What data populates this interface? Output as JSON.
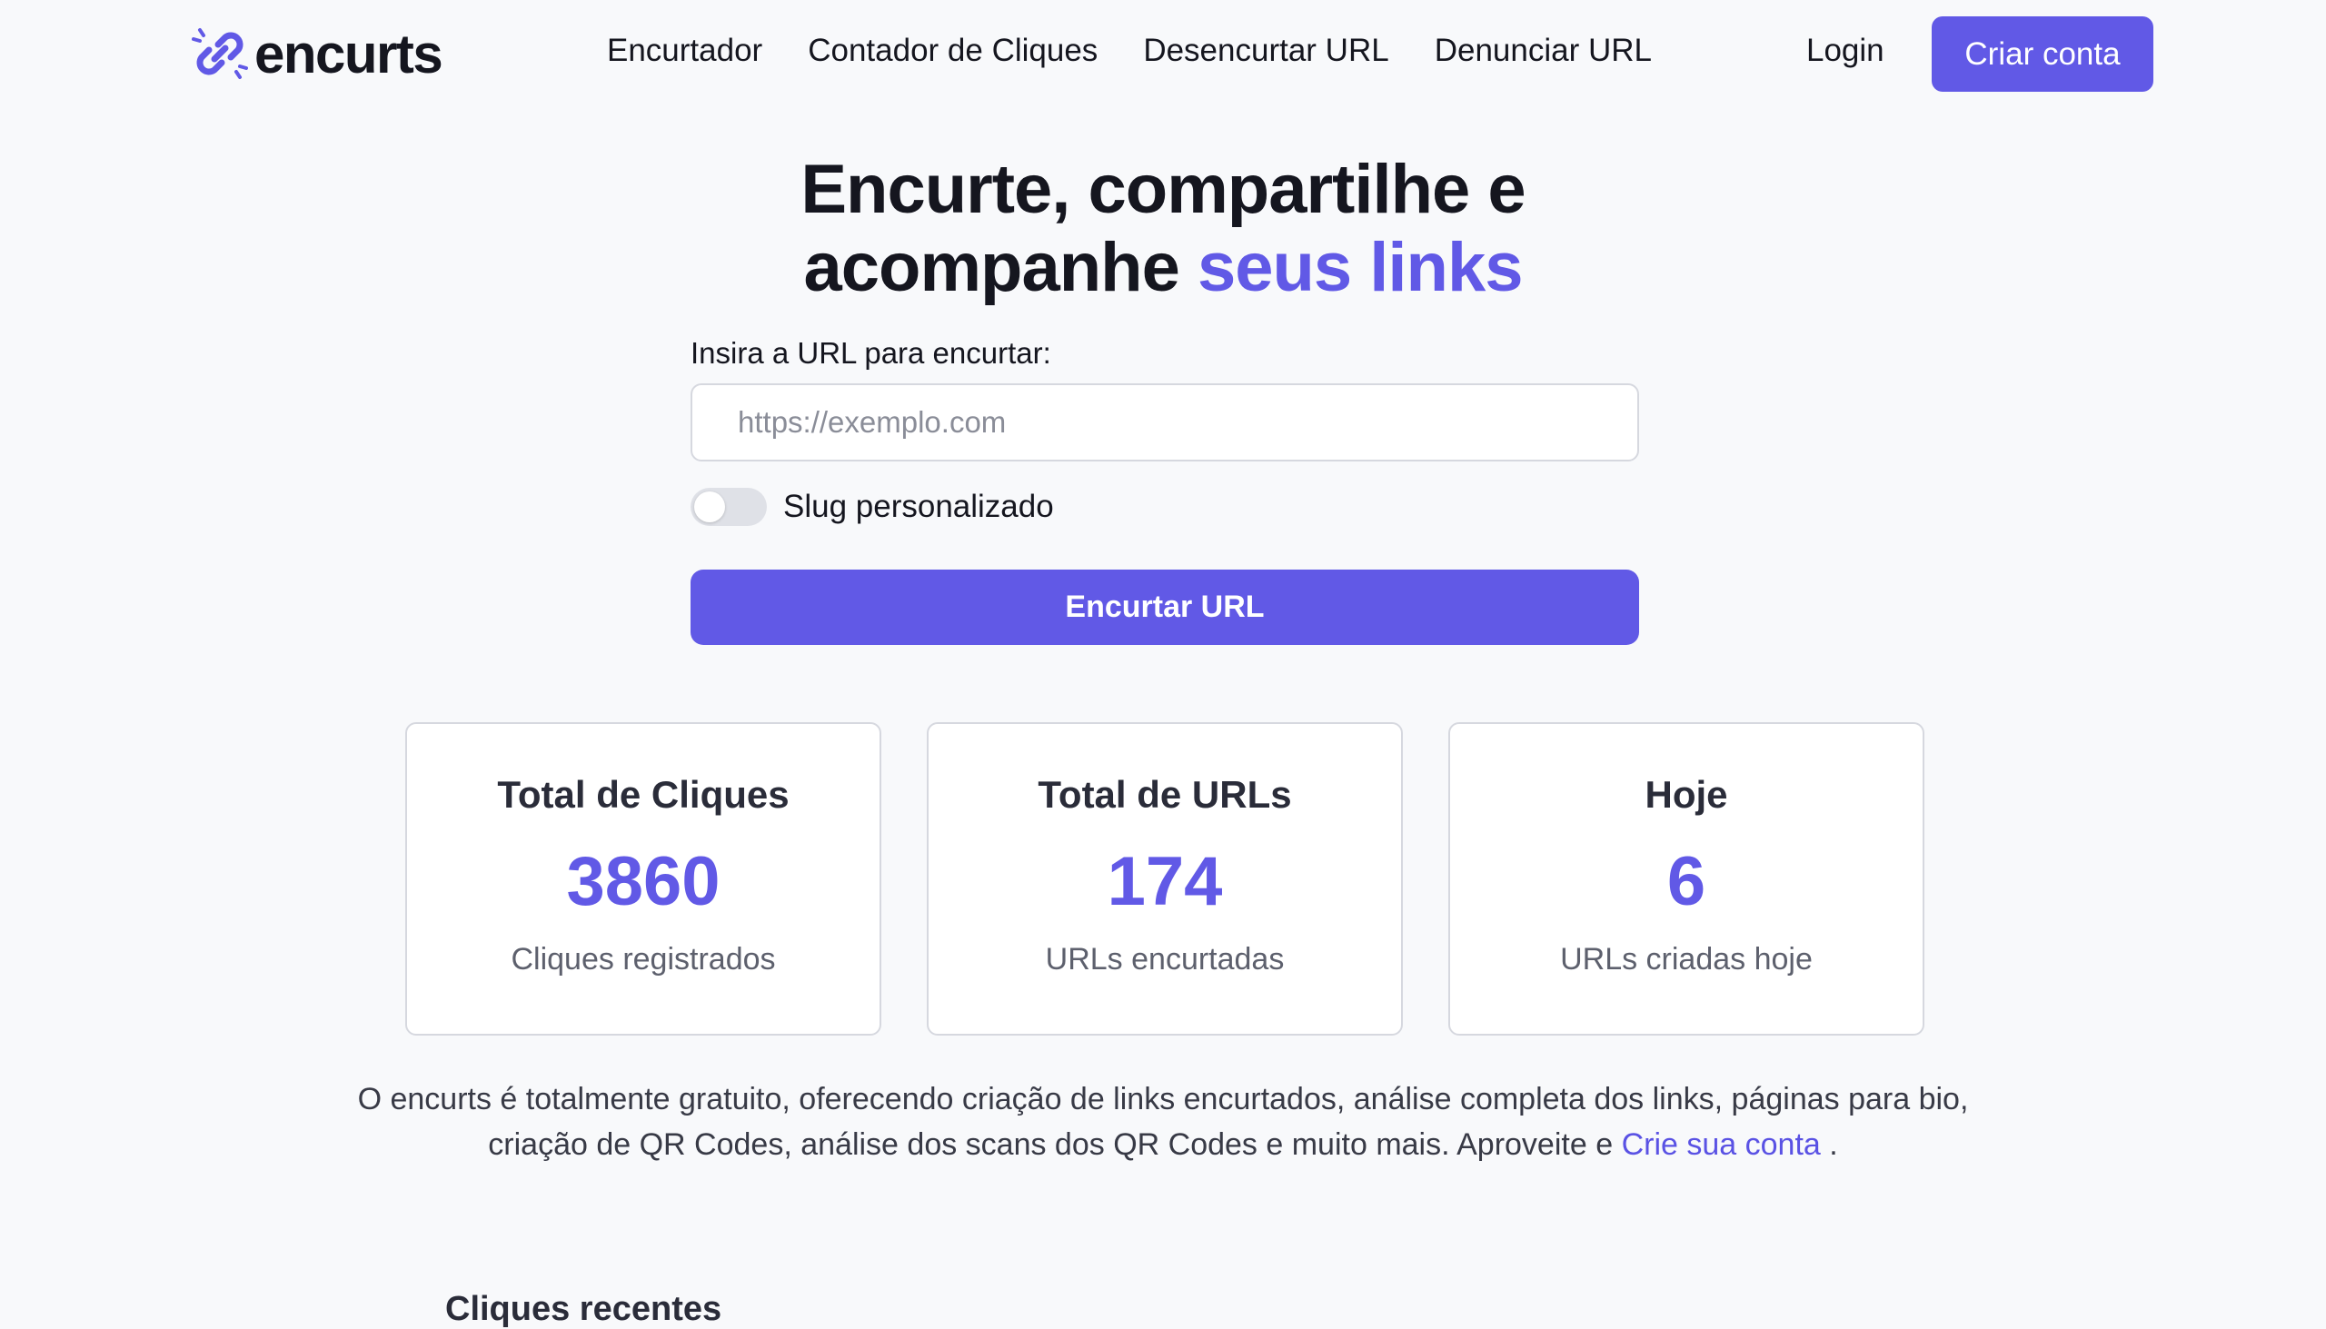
{
  "brand": {
    "name": "encurts",
    "accent_color": "#6159e6"
  },
  "nav": {
    "items": [
      {
        "label": "Encurtador"
      },
      {
        "label": "Contador de Cliques"
      },
      {
        "label": "Desencurtar URL"
      },
      {
        "label": "Denunciar URL"
      }
    ],
    "login_label": "Login",
    "signup_label": "Criar conta"
  },
  "hero": {
    "title_line1": "Encurte, compartilhe e",
    "title_line2_plain": "acompanhe",
    "title_line2_accent": "seus links"
  },
  "form": {
    "url_label": "Insira a URL para encurtar:",
    "url_placeholder": "https://exemplo.com",
    "url_value": "",
    "slug_toggle_label": "Slug personalizado",
    "slug_toggle_on": false,
    "submit_label": "Encurtar URL"
  },
  "stats": [
    {
      "title": "Total de Cliques",
      "value": "3860",
      "subtitle": "Cliques registrados"
    },
    {
      "title": "Total de URLs",
      "value": "174",
      "subtitle": "URLs encurtadas"
    },
    {
      "title": "Hoje",
      "value": "6",
      "subtitle": "URLs criadas hoje"
    }
  ],
  "description": {
    "text": "O encurts é totalmente gratuito, oferecendo criação de links encurtados, análise completa dos links, páginas para bio, criação de QR Codes, análise dos scans dos QR Codes e muito mais. Aproveite e",
    "link_label": "Crie sua conta",
    "trailing": " ."
  },
  "partial_section_heading": "Cliques recentes"
}
